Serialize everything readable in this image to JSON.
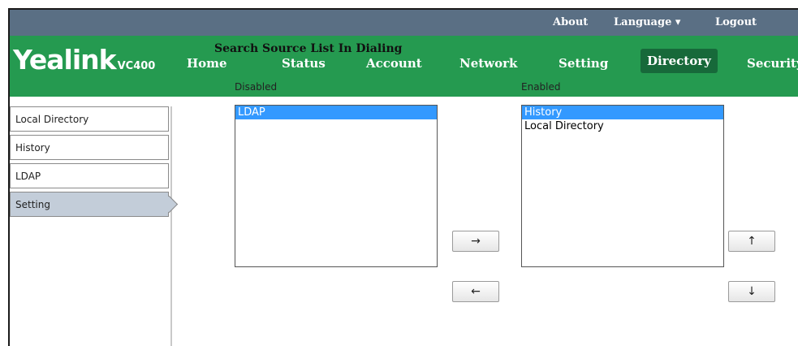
{
  "topbar": {
    "about": "About",
    "language": "Language ▾",
    "logout": "Logout"
  },
  "brand": {
    "name": "Yealink",
    "model": "VC400"
  },
  "nav": [
    "Home",
    "Status",
    "Account",
    "Network",
    "Setting",
    "Directory",
    "Security"
  ],
  "nav_active": "Directory",
  "sidebar": {
    "items": [
      "Local Directory",
      "History",
      "LDAP",
      "Setting"
    ],
    "active": "Setting"
  },
  "main": {
    "title": "Search Source List In Dialing",
    "disabled_label": "Disabled",
    "enabled_label": "Enabled",
    "disabled_items": [
      "LDAP"
    ],
    "enabled_items": [
      "History",
      "Local Directory"
    ],
    "selected_disabled": "LDAP",
    "selected_enabled": "History"
  },
  "buttons": {
    "move_right": "→",
    "move_left": "←",
    "move_up": "↑",
    "move_down": "↓"
  },
  "colors": {
    "topbar": "#5a6f84",
    "navbar": "#259a50",
    "nav_active": "#17693a",
    "selection": "#3399ff",
    "sidebar_active": "#c3cdd9"
  }
}
